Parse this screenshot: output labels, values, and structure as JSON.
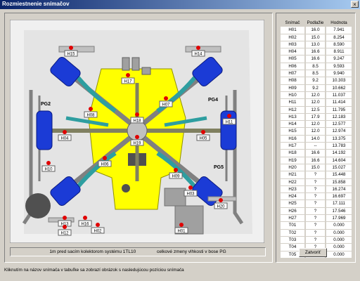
{
  "window": {
    "title": "Rozmiestnenie snímačov",
    "close_glyph": "×"
  },
  "table": {
    "headers": [
      "Snímač",
      "Podlažie",
      "Hodnota"
    ],
    "rows": [
      [
        "H01",
        "16.0",
        "7.941"
      ],
      [
        "H02",
        "15.0",
        "8.254"
      ],
      [
        "H03",
        "13.0",
        "8.590"
      ],
      [
        "H04",
        "16.6",
        "8.911"
      ],
      [
        "H05",
        "16.6",
        "9.247"
      ],
      [
        "H06",
        "8.5",
        "9.593"
      ],
      [
        "H07",
        "8.5",
        "9.940"
      ],
      [
        "H08",
        "9.2",
        "10.303"
      ],
      [
        "H09",
        "9.2",
        "10.662"
      ],
      [
        "H10",
        "12.0",
        "11.037"
      ],
      [
        "H11",
        "12.0",
        "11.414"
      ],
      [
        "H12",
        "12.5",
        "11.795"
      ],
      [
        "H13",
        "17.9",
        "12.183"
      ],
      [
        "H14",
        "12.0",
        "12.577"
      ],
      [
        "H15",
        "12.0",
        "12.974"
      ],
      [
        "H16",
        "14.0",
        "13.375"
      ],
      [
        "H17",
        "--",
        "13.783"
      ],
      [
        "H18",
        "16.6",
        "14.192"
      ],
      [
        "H19",
        "16.6",
        "14.604"
      ],
      [
        "H20",
        "15.0",
        "15.027"
      ],
      [
        "H21",
        "?",
        "15.448"
      ],
      [
        "H22",
        "?",
        "15.858"
      ],
      [
        "H23",
        "?",
        "16.274"
      ],
      [
        "H24",
        "?",
        "16.697"
      ],
      [
        "H25",
        "?",
        "17.111"
      ],
      [
        "H26",
        "?",
        "17.546"
      ],
      [
        "H27",
        "?",
        "17.969"
      ],
      [
        "T01",
        "?",
        "0.000"
      ],
      [
        "T02",
        "?",
        "0.000"
      ],
      [
        "T03",
        "?",
        "0.000"
      ],
      [
        "T04",
        "?",
        "0.000"
      ],
      [
        "T05",
        "?",
        "0.000"
      ]
    ]
  },
  "status": {
    "left": "1m pred sacím kolektorom systému 1TL10",
    "right": "celkové zmeny vlhkosti v bose PG"
  },
  "close_button": "Zatvoriť",
  "footer": "Kliknutím na názov snímača v tabuľke sa zobrazí obrázok s nasledujúcou pozíciou snímača",
  "diagram": {
    "pg_labels": [
      "PG2",
      "PG4",
      "PG5"
    ],
    "sensor_labels": [
      "H15",
      "H14",
      "H17",
      "H08",
      "H07",
      "H18",
      "H11",
      "H04",
      "H05",
      "H19",
      "H06",
      "H10",
      "H09",
      "H03",
      "H20",
      "H13",
      "H16",
      "H02",
      "H01",
      "H12"
    ]
  },
  "colors": {
    "background": "#f0f0f0",
    "yellow": "#ffff00",
    "blue": "#1b3bd6",
    "teal": "#2e9ea0",
    "red": "#e00000"
  }
}
